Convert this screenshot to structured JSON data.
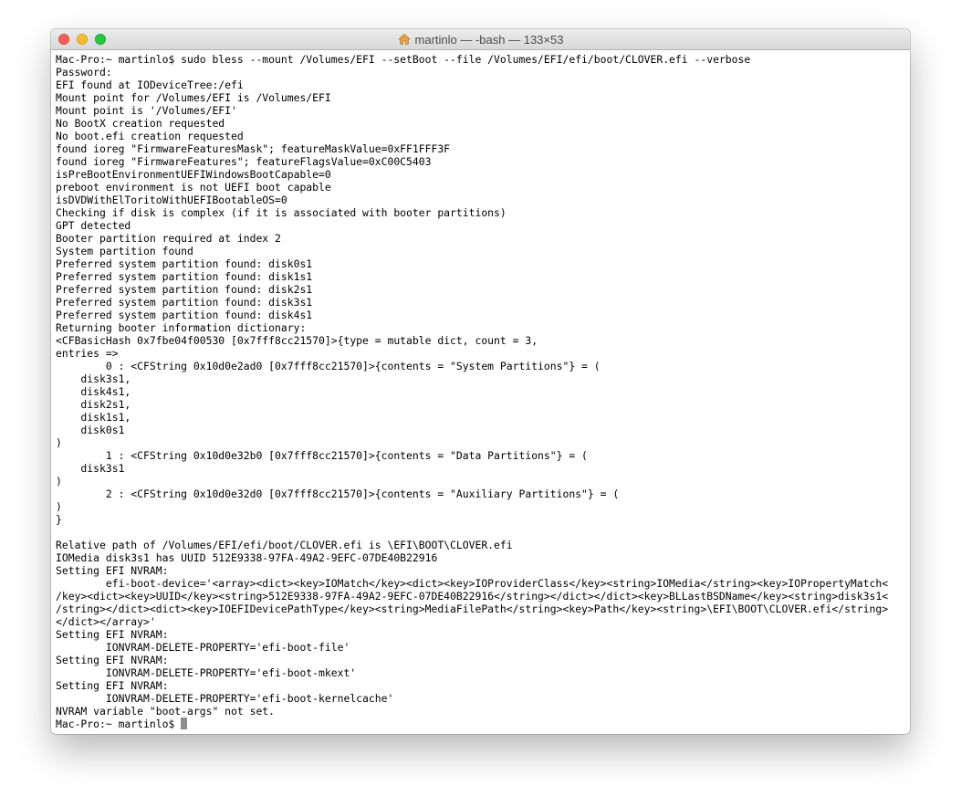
{
  "window": {
    "title": "martinlo — -bash — 133×53",
    "home_icon": "home-icon"
  },
  "terminal": {
    "lines": [
      "Mac-Pro:~ martinlo$ sudo bless --mount /Volumes/EFI --setBoot --file /Volumes/EFI/efi/boot/CLOVER.efi --verbose",
      "Password:",
      "EFI found at IODeviceTree:/efi",
      "Mount point for /Volumes/EFI is /Volumes/EFI",
      "Mount point is '/Volumes/EFI'",
      "No BootX creation requested",
      "No boot.efi creation requested",
      "found ioreg \"FirmwareFeaturesMask\"; featureMaskValue=0xFF1FFF3F",
      "found ioreg \"FirmwareFeatures\"; featureFlagsValue=0xC00C5403",
      "isPreBootEnvironmentUEFIWindowsBootCapable=0",
      "preboot environment is not UEFI boot capable",
      "isDVDWithElToritoWithUEFIBootableOS=0",
      "Checking if disk is complex (if it is associated with booter partitions)",
      "GPT detected",
      "Booter partition required at index 2",
      "System partition found",
      "Preferred system partition found: disk0s1",
      "Preferred system partition found: disk1s1",
      "Preferred system partition found: disk2s1",
      "Preferred system partition found: disk3s1",
      "Preferred system partition found: disk4s1",
      "Returning booter information dictionary:",
      "<CFBasicHash 0x7fbe04f00530 [0x7fff8cc21570]>{type = mutable dict, count = 3,",
      "entries =>",
      "        0 : <CFString 0x10d0e2ad0 [0x7fff8cc21570]>{contents = \"System Partitions\"} = (",
      "    disk3s1,",
      "    disk4s1,",
      "    disk2s1,",
      "    disk1s1,",
      "    disk0s1",
      ")",
      "        1 : <CFString 0x10d0e32b0 [0x7fff8cc21570]>{contents = \"Data Partitions\"} = (",
      "    disk3s1",
      ")",
      "        2 : <CFString 0x10d0e32d0 [0x7fff8cc21570]>{contents = \"Auxiliary Partitions\"} = (",
      ")",
      "}",
      "",
      "Relative path of /Volumes/EFI/efi/boot/CLOVER.efi is \\EFI\\BOOT\\CLOVER.efi",
      "IOMedia disk3s1 has UUID 512E9338-97FA-49A2-9EFC-07DE40B22916",
      "Setting EFI NVRAM:",
      "        efi-boot-device='<array><dict><key>IOMatch</key><dict><key>IOProviderClass</key><string>IOMedia</string><key>IOPropertyMatch<",
      "/key><dict><key>UUID</key><string>512E9338-97FA-49A2-9EFC-07DE40B22916</string></dict></dict><key>BLLastBSDName</key><string>disk3s1<",
      "/string></dict><dict><key>IOEFIDevicePathType</key><string>MediaFilePath</string><key>Path</key><string>\\EFI\\BOOT\\CLOVER.efi</string>",
      "</dict></array>'",
      "Setting EFI NVRAM:",
      "        IONVRAM-DELETE-PROPERTY='efi-boot-file'",
      "Setting EFI NVRAM:",
      "        IONVRAM-DELETE-PROPERTY='efi-boot-mkext'",
      "Setting EFI NVRAM:",
      "        IONVRAM-DELETE-PROPERTY='efi-boot-kernelcache'",
      "NVRAM variable \"boot-args\" not set."
    ],
    "prompt": "Mac-Pro:~ martinlo$ "
  }
}
